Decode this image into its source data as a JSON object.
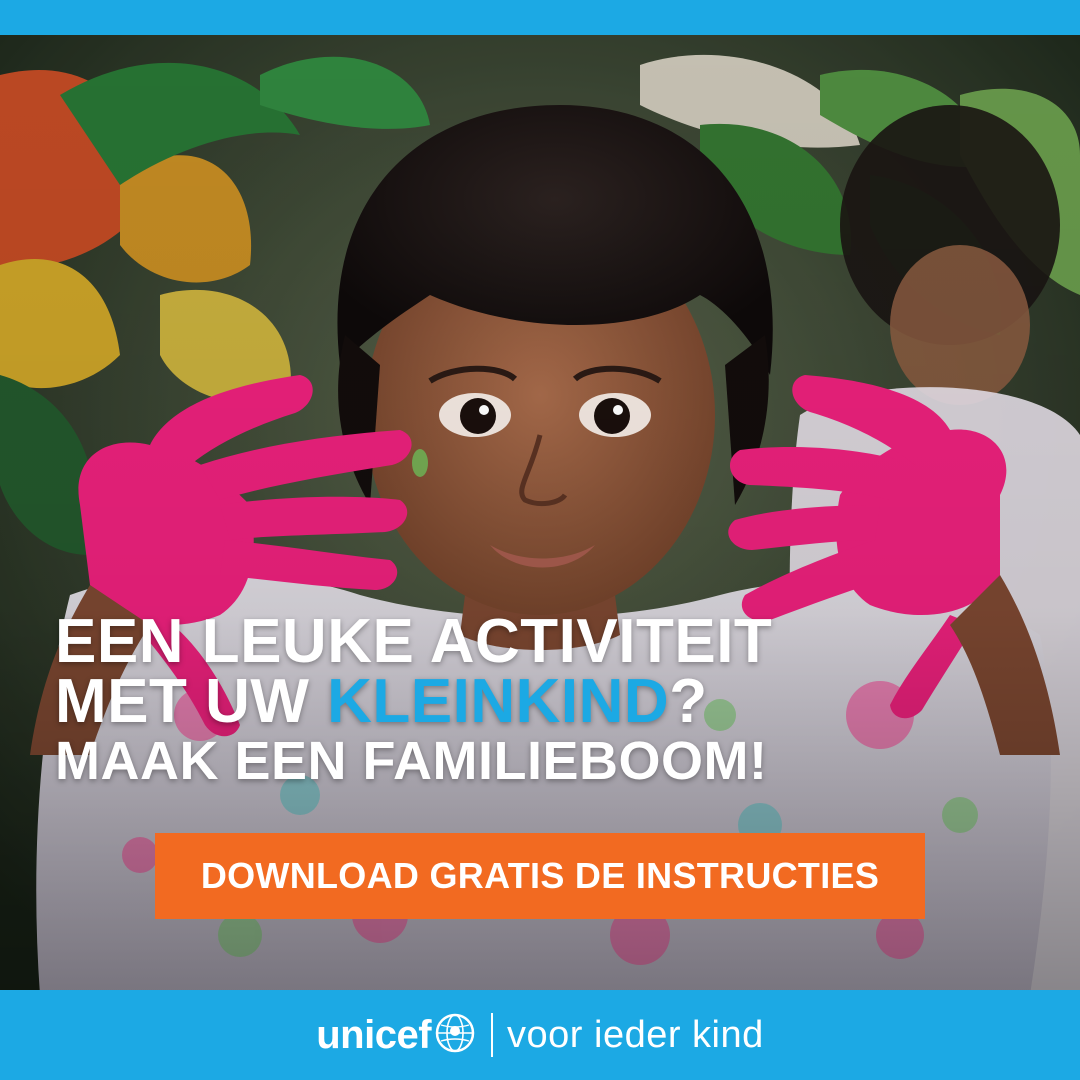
{
  "headline": {
    "line1": "EEN LEUKE ACTIVITEIT",
    "line2_prefix": "MET UW ",
    "line2_highlight": "KLEINKIND",
    "line2_suffix": "?",
    "line3": "MAAK EEN FAMILIEBOOM!"
  },
  "cta": {
    "label": "DOWNLOAD GRATIS DE INSTRUCTIES"
  },
  "footer": {
    "brand": "unicef",
    "tagline": "voor ieder kind"
  },
  "colors": {
    "brand_blue": "#1ca9e4",
    "cta_orange": "#f26a21",
    "paint_pink": "#e8207a",
    "text_white": "#ffffff"
  },
  "icons": {
    "emblem": "unicef-globe-emblem-icon"
  }
}
